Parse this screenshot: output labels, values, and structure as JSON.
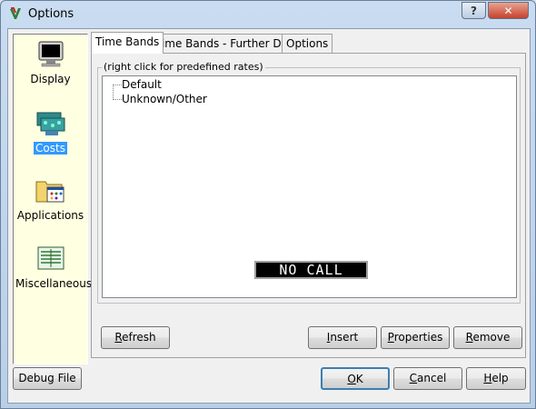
{
  "window": {
    "title": "Options",
    "help_glyph": "?",
    "close_glyph": "✕"
  },
  "sidebar": {
    "items": [
      {
        "label": "Display",
        "icon": "monitor-icon",
        "selected": false
      },
      {
        "label": "Costs",
        "icon": "costs-icon",
        "selected": true
      },
      {
        "label": "Applications",
        "icon": "applications-folder-icon",
        "selected": false
      },
      {
        "label": "Miscellaneous",
        "icon": "miscellaneous-document-icon",
        "selected": false
      }
    ]
  },
  "tabs": [
    {
      "label": "Time Bands",
      "active": true
    },
    {
      "label": "Time Bands - Further Details",
      "active": false
    },
    {
      "label": "Options",
      "active": false
    }
  ],
  "panel": {
    "group_label": "(right click for predefined rates)",
    "tree_items": [
      "Default",
      "Unknown/Other"
    ],
    "status_display": "NO CALL"
  },
  "panel_buttons": {
    "refresh_ul": "R",
    "refresh_rest": "efresh",
    "insert_ul": "I",
    "insert_rest": "nsert",
    "properties_ul": "P",
    "properties_rest": "roperties",
    "remove_ul": "R",
    "remove_rest": "emove"
  },
  "footer": {
    "debug_file": "Debug File",
    "ok_ul": "O",
    "ok_rest": "K",
    "cancel_ul": "C",
    "cancel_rest": "ancel",
    "help_ul": "H",
    "help_rest": "elp"
  },
  "colors": {
    "selection": "#3399ff",
    "sidebar_bg": "#ffffe1",
    "lcd_bg": "#000000"
  }
}
